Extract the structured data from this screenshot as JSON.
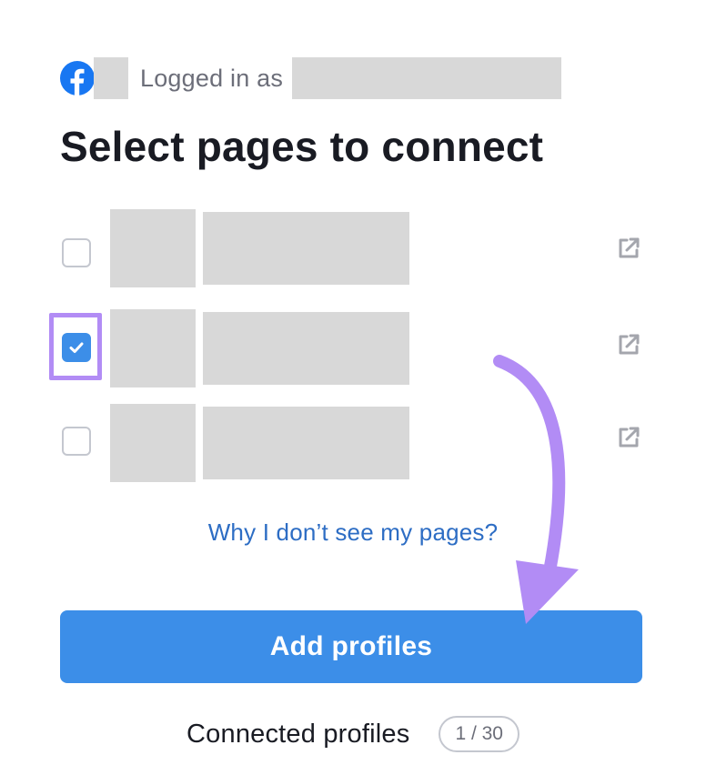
{
  "header": {
    "logged_in_label": "Logged in as",
    "title": "Select pages to connect"
  },
  "icons": {
    "facebook": "facebook-icon",
    "external_link": "external-link-icon",
    "checkmark": "checkmark-icon"
  },
  "pages": [
    {
      "checked": false
    },
    {
      "checked": true
    },
    {
      "checked": false
    }
  ],
  "links": {
    "why_pages": "Why I don’t see my pages?"
  },
  "actions": {
    "add_profiles": "Add profiles"
  },
  "footer": {
    "connected_label": "Connected profiles",
    "count": "1 / 30"
  },
  "colors": {
    "primary": "#3c8ee8",
    "link": "#2d6dc4",
    "facebook": "#1877f2",
    "annotation": "#b28cf5",
    "redaction": "#d8d8d8"
  }
}
